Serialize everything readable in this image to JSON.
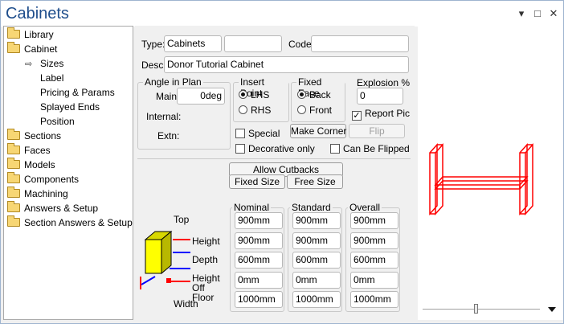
{
  "window": {
    "title": "Cabinets",
    "controls": [
      "▾",
      "□",
      "✕"
    ]
  },
  "tree": [
    {
      "label": "Library",
      "type": "folder"
    },
    {
      "label": "Cabinet",
      "type": "folder-open"
    },
    {
      "label": "Sizes",
      "type": "selected"
    },
    {
      "label": "Label",
      "type": "child"
    },
    {
      "label": "Pricing & Params",
      "type": "child"
    },
    {
      "label": "Splayed Ends",
      "type": "child"
    },
    {
      "label": "Position",
      "type": "child"
    },
    {
      "label": "Sections",
      "type": "folder"
    },
    {
      "label": "Faces",
      "type": "folder"
    },
    {
      "label": "Models",
      "type": "folder"
    },
    {
      "label": "Components",
      "type": "folder"
    },
    {
      "label": "Machining",
      "type": "folder"
    },
    {
      "label": "Answers & Setup",
      "type": "folder"
    },
    {
      "label": "Section Answers & Setup",
      "type": "folder"
    }
  ],
  "form": {
    "type_label": "Type:",
    "type_value": "Cabinets",
    "type_extra": "",
    "code_label": "Code:",
    "code_value": "",
    "desc_label": "Desc:",
    "desc_value": "Donor Tutorial Cabinet",
    "angle_group": "Angle in Plan",
    "main_label": "Main:",
    "main_value": "0deg",
    "internal_label": "Internal:",
    "extn_label": "Extn:",
    "insert_group": "Insert Point",
    "lhs_label": "LHS",
    "rhs_label": "RHS",
    "fixed_face_group": "Fixed Face",
    "back_label": "Back",
    "front_label": "Front",
    "explosion_label": "Explosion %",
    "explosion_value": "0",
    "report_pic_label": "Report Pic",
    "special_label": "Special",
    "make_corner_label": "Make Corner",
    "flip_label": "Flip",
    "decorative_label": "Decorative only",
    "can_be_flipped_label": "Can Be Flipped",
    "allow_cutbacks_label": "Allow Cutbacks",
    "fixed_size_label": "Fixed Size",
    "free_size_label": "Free Size"
  },
  "sizes": {
    "headers": [
      "Nominal",
      "Standard",
      "Overall"
    ],
    "row_labels": [
      "Top",
      "Height",
      "Depth",
      "Height Off Floor",
      "Width"
    ],
    "rows": [
      [
        "900mm",
        "900mm",
        "900mm"
      ],
      [
        "900mm",
        "900mm",
        "900mm"
      ],
      [
        "600mm",
        "600mm",
        "600mm"
      ],
      [
        "0mm",
        "0mm",
        "0mm"
      ],
      [
        "1000mm",
        "1000mm",
        "1000mm"
      ]
    ]
  },
  "colors": {
    "title": "#1f4e8c",
    "wireframe": "#ff0000",
    "box": "#ffff00"
  }
}
